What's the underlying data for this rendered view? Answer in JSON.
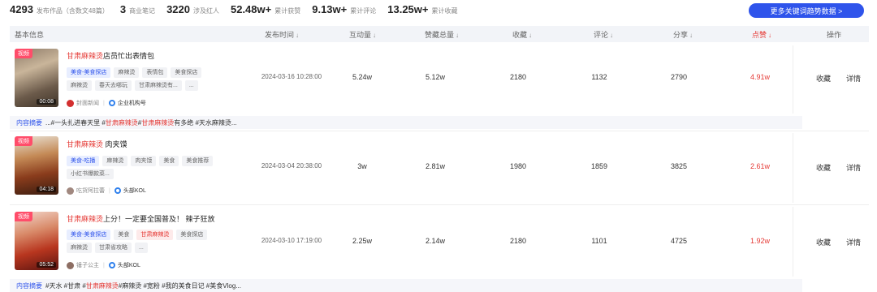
{
  "stats": [
    {
      "num": "4293",
      "label": "发布作品（含数文48篇）"
    },
    {
      "num": "3",
      "label": "商业笔记"
    },
    {
      "num": "3220",
      "label": "涉及红人"
    },
    {
      "num": "52.48w+",
      "label": "累计获赞"
    },
    {
      "num": "9.13w+",
      "label": "累计评论"
    },
    {
      "num": "13.25w+",
      "label": "累计收藏"
    }
  ],
  "more_button": "更多关键词趋势数据 >",
  "header": {
    "basic": "基本信息",
    "time": "发布时间",
    "interact": "互动量",
    "likes_total": "赞藏总量",
    "collect": "收藏",
    "comment": "评论",
    "share": "分享",
    "like": "点赞",
    "ops": "操作",
    "arrow": "↓"
  },
  "rows": [
    {
      "tag": "视频",
      "duration": "00:08",
      "title_hl": "甘肃麻辣烫",
      "title_rest": "店员忙出表情包",
      "chips": [
        {
          "text": "美食-美食探店",
          "kind": "blue"
        },
        {
          "text": "麻辣烫",
          "kind": ""
        },
        {
          "text": "表情包",
          "kind": ""
        },
        {
          "text": "美食探店",
          "kind": ""
        },
        {
          "text": "麻辣烫",
          "kind": ""
        },
        {
          "text": "春天去哪玩",
          "kind": ""
        },
        {
          "text": "甘肃麻辣烫有...",
          "kind": ""
        },
        {
          "text": "...",
          "kind": ""
        }
      ],
      "author": "封面新闻",
      "author_color": "#d32f2f",
      "badge": "企业机构号",
      "date": "2024-03-16 10:28:00",
      "interact": "5.24w",
      "likes_total": "5.12w",
      "collect": "2180",
      "comment": "1132",
      "share": "2790",
      "like": "4.91w",
      "op_collect": "收藏",
      "op_detail": "详情",
      "summary_label": "内容摘要",
      "summary_pre": "...#一头扎进春天里 #",
      "summary_hl1": "甘肃麻辣烫",
      "summary_mid": " #",
      "summary_hl2": "甘肃麻辣烫",
      "summary_post": "有多绝 #天水麻辣烫..."
    },
    {
      "tag": "视频",
      "duration": "04:18",
      "title_hl": "甘肃麻辣烫",
      "title_rest": " 肉夹馍",
      "chips": [
        {
          "text": "美食-吃播",
          "kind": "blue"
        },
        {
          "text": "麻辣烫",
          "kind": ""
        },
        {
          "text": "肉夹馍",
          "kind": ""
        },
        {
          "text": "美食",
          "kind": ""
        },
        {
          "text": "美食推荐",
          "kind": ""
        },
        {
          "text": "小红书爆款菜...",
          "kind": ""
        }
      ],
      "author": "吃货阿拉蕾",
      "author_color": "#a1887f",
      "badge": "头部KOL",
      "date": "2024-03-04 20:38:00",
      "interact": "3w",
      "likes_total": "2.81w",
      "collect": "1980",
      "comment": "1859",
      "share": "3825",
      "like": "2.61w",
      "op_collect": "收藏",
      "op_detail": "详情"
    },
    {
      "tag": "视频",
      "duration": "05:52",
      "title_hl": "甘肃麻辣烫",
      "title_rest": "上分！一定要全国普及！ 辣子狂放",
      "chips": [
        {
          "text": "美食-美食探店",
          "kind": "blue"
        },
        {
          "text": "美食",
          "kind": ""
        },
        {
          "text": "甘肃麻辣烫",
          "kind": "red"
        },
        {
          "text": "美食探店",
          "kind": ""
        },
        {
          "text": "麻辣烫",
          "kind": ""
        },
        {
          "text": "甘肃省攻略",
          "kind": ""
        },
        {
          "text": "...",
          "kind": ""
        }
      ],
      "author": "锤子公主",
      "author_color": "#8d6e63",
      "badge": "头部KOL",
      "date": "2024-03-10 17:19:00",
      "interact": "2.25w",
      "likes_total": "2.14w",
      "collect": "2180",
      "comment": "1101",
      "share": "4725",
      "like": "1.92w",
      "op_collect": "收藏",
      "op_detail": "详情",
      "summary_label": "内容摘要",
      "summary_pre": "#天水 #甘肃 #",
      "summary_hl1": "甘肃麻辣烫",
      "summary_mid": "",
      "summary_hl2": "",
      "summary_post": " #麻辣烫 #宽粉 #我的美食日记 #美食Vlog..."
    }
  ],
  "colors": {
    "accent": "#2f54eb",
    "red": "#e53935",
    "tag": "#ff4d6a"
  }
}
